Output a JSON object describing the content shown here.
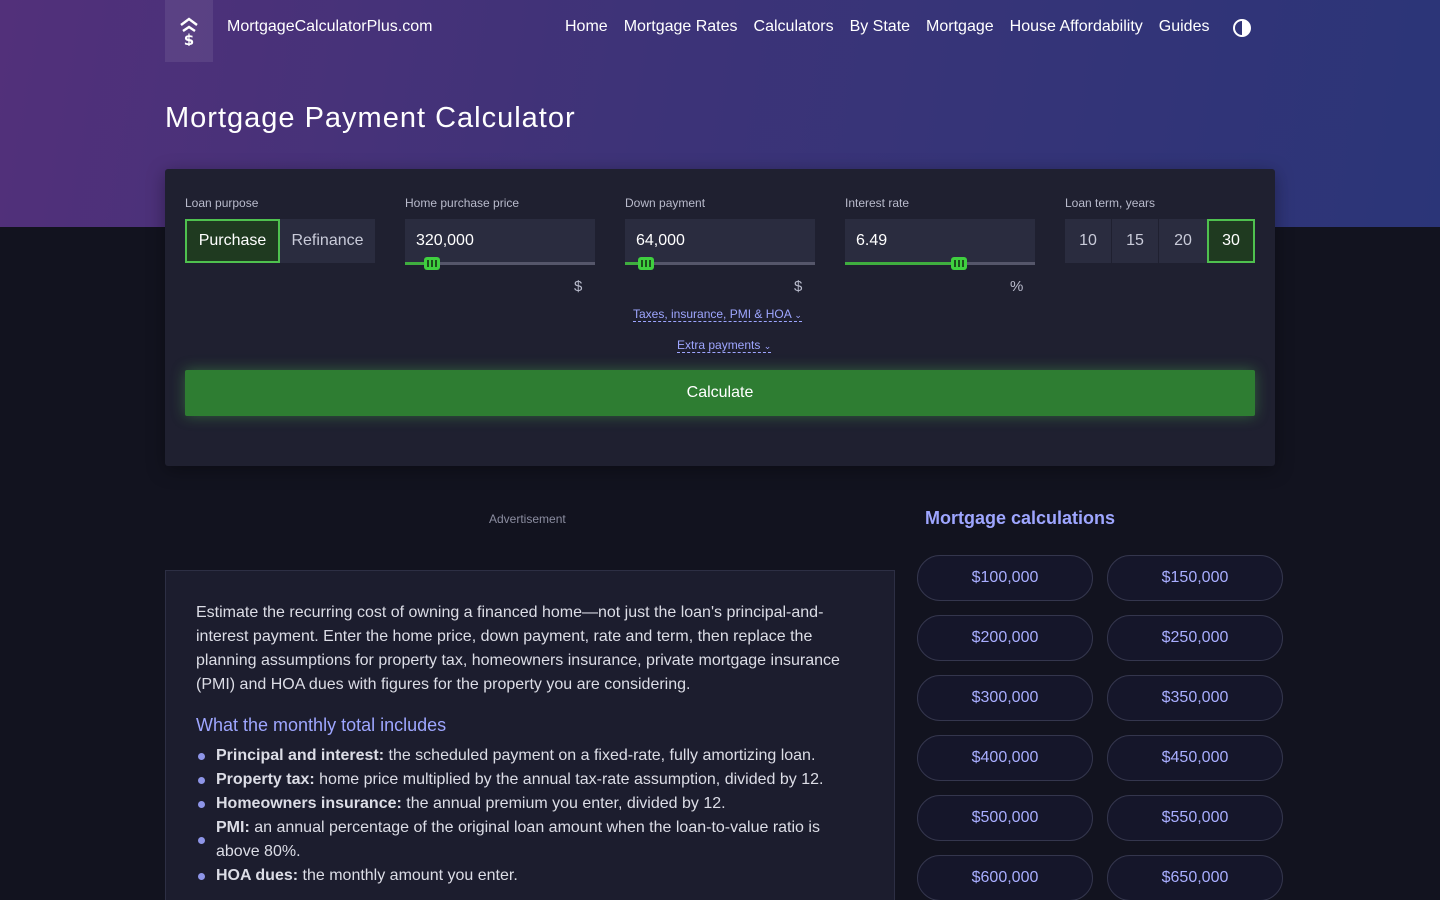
{
  "header": {
    "site_name": "MortgageCalculatorPlus.com",
    "logo_icon": "dollar-up-arrow-icon",
    "nav": [
      "Home",
      "Mortgage Rates",
      "Calculators",
      "By State",
      "Mortgage",
      "House Affordability",
      "Guides"
    ],
    "theme_toggle_icon": "contrast-icon"
  },
  "page_title": "Mortgage Payment Calculator",
  "calculator": {
    "loan_purpose": {
      "label": "Loan purpose",
      "options": [
        "Purchase",
        "Refinance"
      ],
      "selected": "Purchase"
    },
    "home_price": {
      "label": "Home purchase price",
      "value": "320,000",
      "unit": "$",
      "slider_fraction": 0.14
    },
    "down_payment": {
      "label": "Down payment",
      "value": "64,000",
      "unit": "$",
      "slider_fraction": 0.11
    },
    "interest_rate": {
      "label": "Interest rate",
      "value": "6.49",
      "unit": "%",
      "slider_fraction": 0.6
    },
    "loan_term": {
      "label": "Loan term, years",
      "options": [
        "10",
        "15",
        "20",
        "30"
      ],
      "selected": "30"
    },
    "taxes_link": "Taxes, insurance, PMI & HOA",
    "extra_link": "Extra payments",
    "calculate_label": "Calculate"
  },
  "advertisement_label": "Advertisement",
  "article": {
    "intro": "Estimate the recurring cost of owning a financed home—not just the loan's principal-and-interest payment. Enter the home price, down payment, rate and term, then replace the planning assumptions for property tax, homeowners insurance, private mortgage insurance (PMI) and HOA dues with figures for the property you are considering.",
    "heading": "What the monthly total includes",
    "items": [
      {
        "term": "Principal and interest:",
        "text": " the scheduled payment on a fixed-rate, fully amortizing loan."
      },
      {
        "term": "Property tax:",
        "text": " home price multiplied by the annual tax-rate assumption, divided by 12."
      },
      {
        "term": "Homeowners insurance:",
        "text": " the annual premium you enter, divided by 12."
      },
      {
        "term": "PMI:",
        "text": " an annual percentage of the original loan amount when the loan-to-value ratio is above 80%."
      },
      {
        "term": "HOA dues:",
        "text": " the monthly amount you enter."
      }
    ]
  },
  "sidebar": {
    "title": "Mortgage calculations",
    "amounts": [
      "$100,000",
      "$150,000",
      "$200,000",
      "$250,000",
      "$300,000",
      "$350,000",
      "$400,000",
      "$450,000",
      "$500,000",
      "$550,000",
      "$600,000",
      "$650,000"
    ]
  }
}
